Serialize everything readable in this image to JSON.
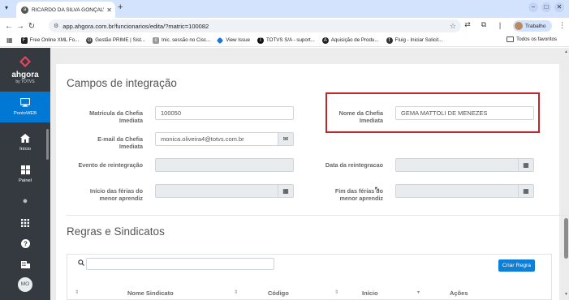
{
  "browser": {
    "tab_title": "RICARDO DA SILVA GONÇALVE",
    "url": "app.ahgora.com.br/funcionarios/edita/?matric=100082",
    "profile_label": "Trabalho",
    "bookmarks": [
      {
        "label": "Free Online XML Fo...",
        "color": "#222222"
      },
      {
        "label": "Gestão PRIME | Sist...",
        "color": "#444444"
      },
      {
        "label": "Inic. sessão no Cisc...",
        "color": "#888888"
      },
      {
        "label": "View Issue",
        "color": "#1a73e8"
      },
      {
        "label": "TOTVS S/A - suport...",
        "color": "#111111"
      },
      {
        "label": "Aquisição de Produ...",
        "color": "#222222"
      },
      {
        "label": "Fluig - Iniciar Solicit...",
        "color": "#333333"
      }
    ],
    "all_bookmarks_label": "Todos os favoritos"
  },
  "sidebar": {
    "logo_text": "ahgora",
    "logo_sub": "by TOTVS",
    "active_item": "PontoWEB",
    "items": [
      {
        "label": "Início",
        "icon": "home-icon"
      },
      {
        "label": "Painel",
        "icon": "grid-icon"
      }
    ],
    "avatar": "MO",
    "brand_color": "#0078d4"
  },
  "integration": {
    "title": "Campos de integração",
    "matricula_label": "Matrícula da Chefia Imediata",
    "matricula_value": "100050",
    "nome_label": "Nome da Chefia Imediata",
    "nome_value": "GEMA MATTOLI DE MENEZES",
    "email_label": "E-mail da Chefia Imediata",
    "email_value": "monica.oliveira4@totvs.com.br",
    "evento_label": "Evento de reintegração",
    "evento_value": "",
    "data_label": "Data da reintegracao",
    "data_value": "",
    "inicio_label": "Início das férias do menor aprendiz",
    "inicio_value": "",
    "fim_label": "Fim das férias do menor aprendiz",
    "fim_value": ""
  },
  "rules": {
    "title": "Regras e Sindicatos",
    "search_value": "",
    "create_button": "Criar Regra",
    "columns": [
      "Nome Sindicato",
      "Código",
      "Início",
      "Ações"
    ]
  }
}
